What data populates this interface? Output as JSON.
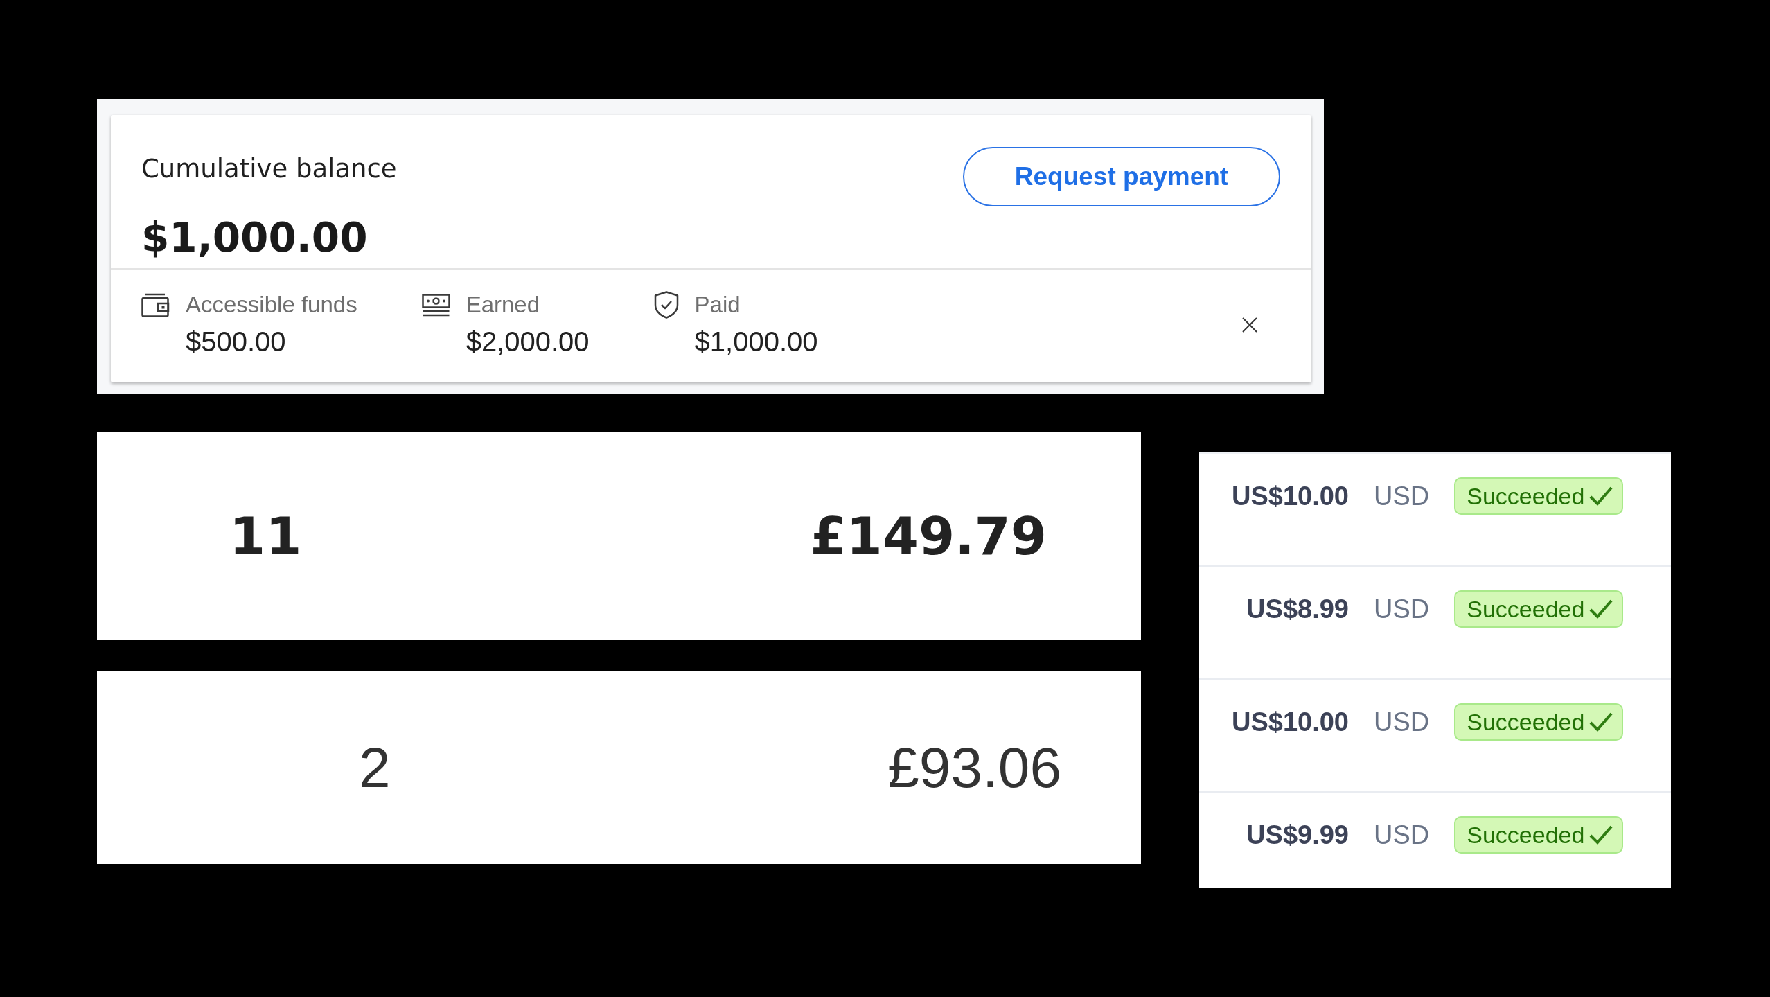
{
  "balance_card": {
    "title": "Cumulative balance",
    "amount": "$1,000.00",
    "request_button": "Request payment",
    "stats": [
      {
        "kind": "wallet",
        "label": "Accessible funds",
        "value": "$500.00"
      },
      {
        "kind": "banknote",
        "label": "Earned",
        "value": "$2,000.00"
      },
      {
        "kind": "shield",
        "label": "Paid",
        "value": "$1,000.00"
      }
    ]
  },
  "summary_rows": [
    {
      "kind": "total",
      "column_1": "11",
      "column_2": "£149.79"
    },
    {
      "kind": "line",
      "column_1": "2",
      "column_2": "£93.06"
    }
  ],
  "payments": [
    {
      "amount": "US$10.00",
      "currency": "USD",
      "status": {
        "kind": "succeeded",
        "label": "Succeeded"
      }
    },
    {
      "amount": "US$8.99",
      "currency": "USD",
      "status": {
        "kind": "succeeded",
        "label": "Succeeded"
      }
    },
    {
      "amount": "US$10.00",
      "currency": "USD",
      "status": {
        "kind": "succeeded",
        "label": "Succeeded"
      }
    },
    {
      "amount": "US$9.99",
      "currency": "USD",
      "status": {
        "kind": "succeeded",
        "label": "Succeeded"
      }
    }
  ]
}
